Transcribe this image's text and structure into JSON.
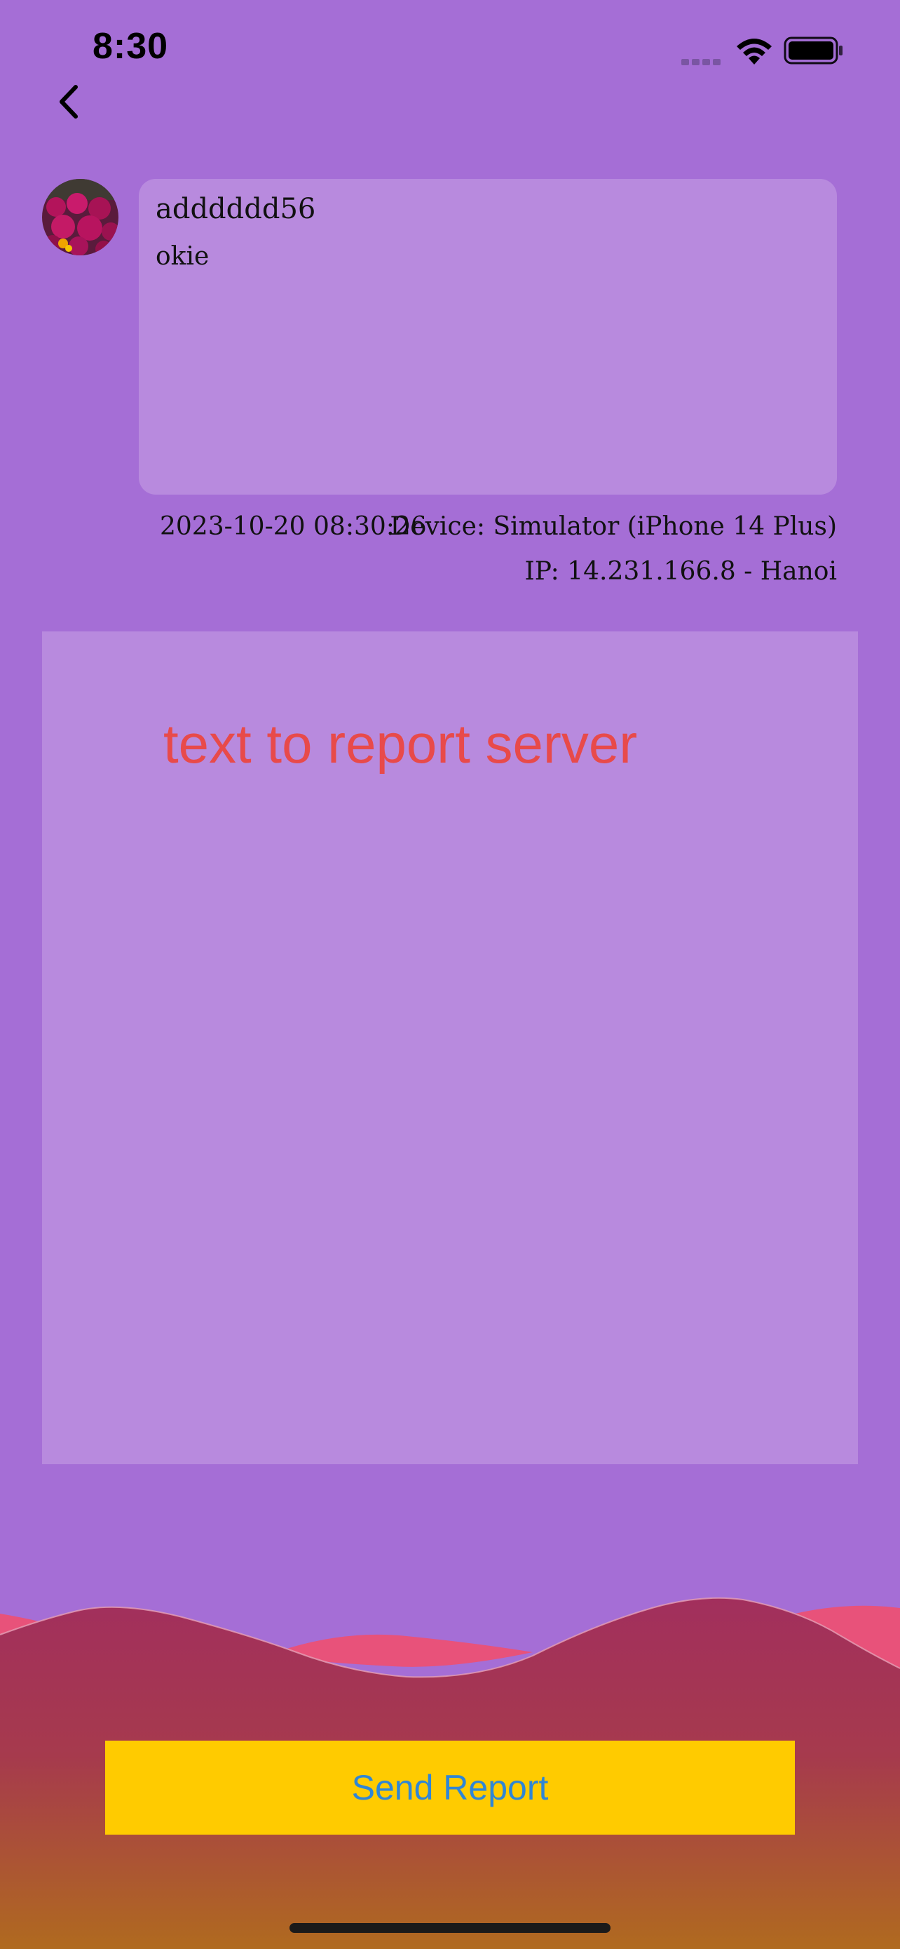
{
  "status_bar": {
    "time": "8:30",
    "icons": [
      "signal-icon",
      "wifi-icon",
      "battery-icon"
    ]
  },
  "nav": {
    "back_icon": "chevron-left-icon"
  },
  "message": {
    "username": "adddddd56",
    "text": "okie",
    "avatar_icon": "flower-avatar"
  },
  "meta": {
    "date": "2023-10-20 08:30:26",
    "device": "Device: Simulator (iPhone 14 Plus)",
    "ip": "IP: 14.231.166.8 - Hanoi"
  },
  "report": {
    "text": "text to report server"
  },
  "actions": {
    "send_label": "Send Report"
  },
  "colors": {
    "background": "#a56ed6",
    "card": "#b88ade",
    "report_text": "#e84a4a",
    "button": "#ffcb00",
    "button_text": "#2f86d6"
  }
}
